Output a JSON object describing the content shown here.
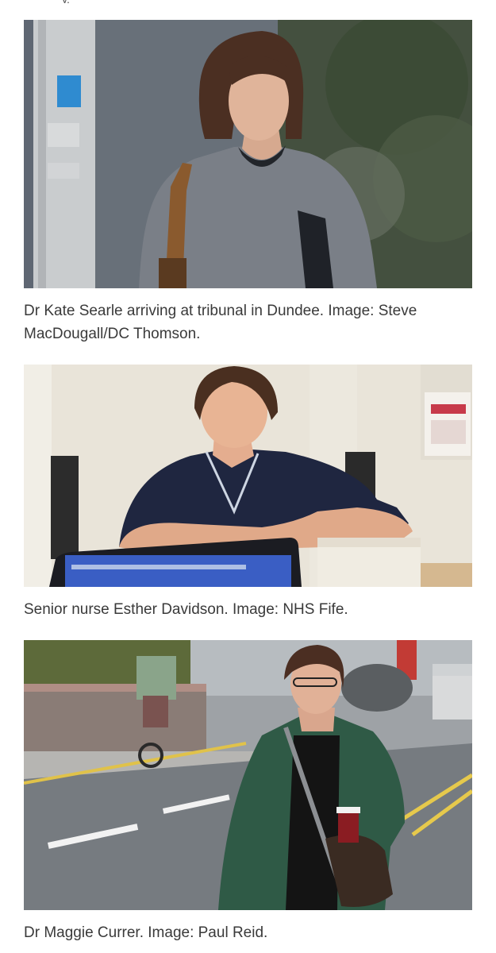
{
  "figures": [
    {
      "caption": "Dr Kate Searle arriving at tribunal in Dundee. Image: Steve MacDougall/DC Thomson."
    },
    {
      "caption": "Senior nurse Esther Davidson. Image: NHS Fife."
    },
    {
      "caption": "Dr Maggie Currer. Image: Paul Reid."
    }
  ],
  "colors": {
    "caption_text": "#3a3a3a",
    "background": "#ffffff"
  }
}
